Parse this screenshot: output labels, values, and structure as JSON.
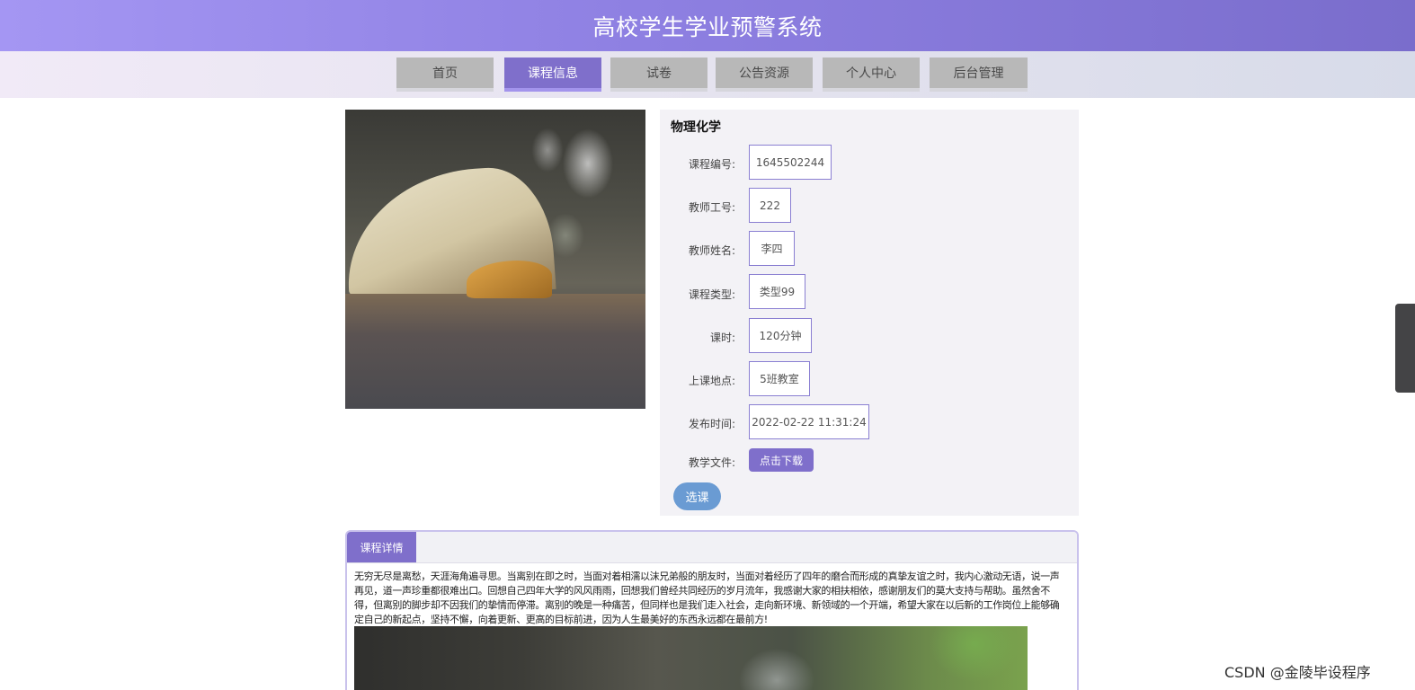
{
  "header": {
    "title": "高校学生学业预警系统"
  },
  "nav": {
    "items": [
      {
        "label": "首页"
      },
      {
        "label": "课程信息",
        "active": true
      },
      {
        "label": "试卷"
      },
      {
        "label": "公告资源"
      },
      {
        "label": "个人中心"
      },
      {
        "label": "后台管理"
      }
    ]
  },
  "course": {
    "name": "物理化学",
    "fields": [
      {
        "label": "课程编号:",
        "value": "1645502244"
      },
      {
        "label": "教师工号:",
        "value": "222"
      },
      {
        "label": "教师姓名:",
        "value": "李四"
      },
      {
        "label": "课程类型:",
        "value": "类型99"
      },
      {
        "label": "课时:",
        "value": "120分钟"
      },
      {
        "label": "上课地点:",
        "value": "5班教室"
      },
      {
        "label": "发布时间:",
        "value": "2022-02-22 11:31:24"
      }
    ],
    "file_label": "教学文件:",
    "download_label": "点击下载",
    "select_label": "选课"
  },
  "detail": {
    "tab_label": "课程详情",
    "text": "无穷无尽是离愁，天涯海角遍寻思。当离别在即之时，当面对着相濡以沫兄弟般的朋友时，当面对着经历了四年的磨合而形成的真挚友谊之时，我内心激动无语，说一声再见，道一声珍重都很难出口。回想自己四年大学的风风雨雨，回想我们曾经共同经历的岁月流年，我感谢大家的相扶相依，感谢朋友们的莫大支持与帮助。虽然舍不得，但离别的脚步却不因我们的挚情而停滞。离别的晚是一种痛苦，但同样也是我们走入社会，走向新环境、新领域的一个开端，希望大家在以后新的工作岗位上能够确定自己的新起点，坚持不懈，向着更新、更高的目标前进，因为人生最美好的东西永远都在最前方!"
  },
  "watermark": "CSDN @金陵毕设程序"
}
